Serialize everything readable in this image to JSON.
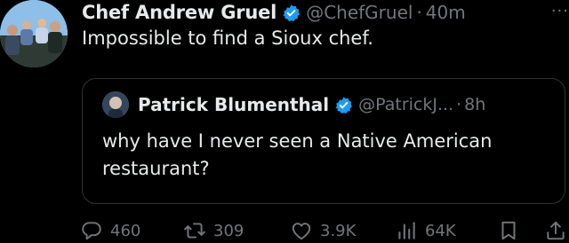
{
  "tweet": {
    "display_name": "Chef Andrew Gruel",
    "handle": "@ChefGruel",
    "separator": "·",
    "time": "40m",
    "more_label": "···",
    "text": "Impossible to find a Sioux chef.",
    "verified_icon": "verified-badge-icon",
    "avatar_icon": "family-photo-avatar"
  },
  "quote": {
    "display_name": "Patrick Blumenthal",
    "handle": "@PatrickJ...",
    "separator": "·",
    "time": "8h",
    "text": "why have I never seen a Native American restaurant?",
    "verified_icon": "verified-badge-icon",
    "avatar_icon": "portrait-avatar"
  },
  "actions": {
    "reply": {
      "icon": "reply-icon",
      "count": "460"
    },
    "retweet": {
      "icon": "retweet-icon",
      "count": "309"
    },
    "like": {
      "icon": "heart-icon",
      "count": "3.9K"
    },
    "views": {
      "icon": "views-chart-icon",
      "count": "64K"
    },
    "bookmark": {
      "icon": "bookmark-icon"
    },
    "share": {
      "icon": "share-icon"
    }
  },
  "colors": {
    "background": "#000000",
    "text_primary": "#e7e9ea",
    "text_secondary": "#71767b",
    "verified_blue": "#1d9bf0",
    "border": "#2f3336"
  }
}
